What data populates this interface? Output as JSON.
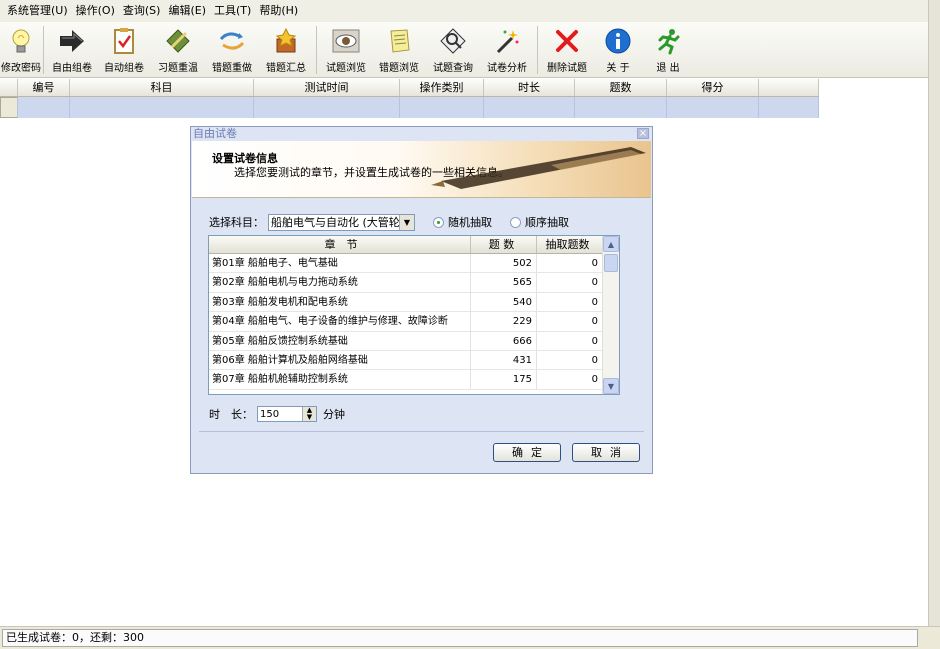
{
  "menubar": {
    "items": [
      "系统管理(U)",
      "操作(O)",
      "查询(S)",
      "编辑(E)",
      "工具(T)",
      "帮助(H)"
    ]
  },
  "toolbar": {
    "buttons": [
      {
        "label": "修改密码",
        "icon": "lightbulb-icon"
      },
      {
        "label": "自由组卷",
        "icon": "arrow-right-icon"
      },
      {
        "label": "自动组卷",
        "icon": "clipboard-check-icon"
      },
      {
        "label": "习题重温",
        "icon": "diamond-pencil-icon"
      },
      {
        "label": "错题重做",
        "icon": "recycle-arrows-icon"
      },
      {
        "label": "错题汇总",
        "icon": "box-star-icon"
      },
      {
        "label": "试题浏览",
        "icon": "eye-icon"
      },
      {
        "label": "错题浏览",
        "icon": "notepad-icon"
      },
      {
        "label": "试题查询",
        "icon": "magnifier-icon"
      },
      {
        "label": "试卷分析",
        "icon": "magic-wand-icon"
      },
      {
        "label": "删除试题",
        "icon": "red-x-icon"
      },
      {
        "label": "关 于",
        "icon": "info-icon"
      },
      {
        "label": "退 出",
        "icon": "running-man-icon"
      }
    ]
  },
  "grid": {
    "columns": [
      "编号",
      "科目",
      "测试时间",
      "操作类别",
      "时长",
      "题数",
      "得分",
      ""
    ]
  },
  "dialog": {
    "title": "自由试卷",
    "close": "×",
    "banner_title": "设置试卷信息",
    "banner_sub": "选择您要测试的章节，并设置生成试卷的一些相关信息。",
    "subject_label": "选择科目：",
    "subject_value": "船舶电气与自动化 (大管轮",
    "radio_random": "随机抽取",
    "radio_sequential": "顺序抽取",
    "table_headers": [
      "章　节",
      "题 数",
      "抽取题数"
    ],
    "chapters": [
      {
        "name": "第01章 船舶电子、电气基础",
        "count": "502",
        "pick": "0"
      },
      {
        "name": "第02章 船舶电机与电力拖动系统",
        "count": "565",
        "pick": "0"
      },
      {
        "name": "第03章 船舶发电机和配电系统",
        "count": "540",
        "pick": "0"
      },
      {
        "name": "第04章 船舶电气、电子设备的维护与修理、故障诊断",
        "count": "229",
        "pick": "0"
      },
      {
        "name": "第05章 船舶反馈控制系统基础",
        "count": "666",
        "pick": "0"
      },
      {
        "name": "第06章 船舶计算机及船舶网络基础",
        "count": "431",
        "pick": "0"
      },
      {
        "name": "第07章 船舶机舱辅助控制系统",
        "count": "175",
        "pick": "0"
      }
    ],
    "duration_label": "时　长：",
    "duration_value": "150",
    "duration_unit": "分钟",
    "ok_label": "确定",
    "cancel_label": "取消"
  },
  "status": {
    "text": "已生成试卷：0，还剩：300"
  }
}
